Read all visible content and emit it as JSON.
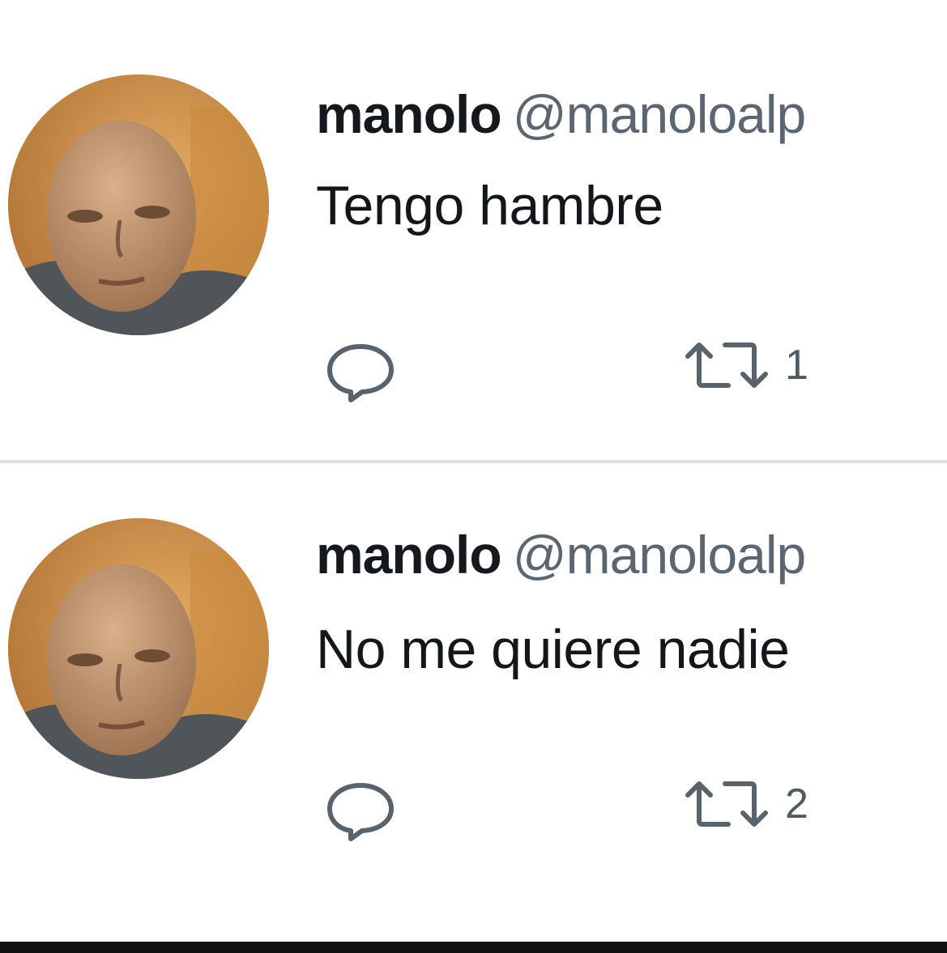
{
  "tweets": [
    {
      "name": "manolo",
      "handle": "@manoloalp",
      "text": "Tengo hambre",
      "retweet_count": "1",
      "avatar_icon": "profile-photo"
    },
    {
      "name": "manolo",
      "handle": "@manoloalp",
      "text": "No me quiere nadie",
      "retweet_count": "2",
      "avatar_icon": "profile-photo"
    }
  ],
  "icons": {
    "reply": "speech-bubble-icon",
    "retweet": "retweet-arrows-icon"
  },
  "colors": {
    "text": "#14171a",
    "secondary": "#5b6670",
    "divider": "#dcdfe2"
  }
}
